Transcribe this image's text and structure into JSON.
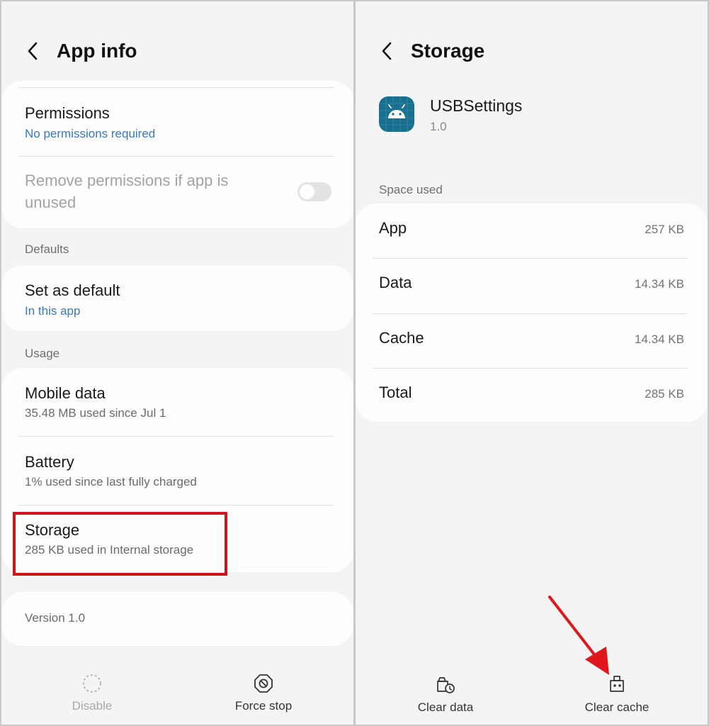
{
  "app_info": {
    "title": "App info",
    "permissions": {
      "title": "Permissions",
      "subtitle": "No permissions required"
    },
    "remove_permissions": {
      "label": "Remove permissions if app is unused",
      "enabled": false
    },
    "sections": {
      "defaults": "Defaults",
      "usage": "Usage"
    },
    "set_as_default": {
      "title": "Set as default",
      "subtitle": "In this app"
    },
    "mobile_data": {
      "title": "Mobile data",
      "subtitle": "35.48 MB used since Jul 1"
    },
    "battery": {
      "title": "Battery",
      "subtitle": "1% used since last fully charged"
    },
    "storage": {
      "title": "Storage",
      "subtitle": "285 KB used in Internal storage"
    },
    "version": "Version 1.0",
    "bottom": {
      "disable": "Disable",
      "force_stop": "Force stop"
    }
  },
  "storage": {
    "title": "Storage",
    "app_name": "USBSettings",
    "app_version": "1.0",
    "space_used_label": "Space used",
    "rows": [
      {
        "label": "App",
        "value": "257 KB"
      },
      {
        "label": "Data",
        "value": "14.34 KB"
      },
      {
        "label": "Cache",
        "value": "14.34 KB"
      },
      {
        "label": "Total",
        "value": "285 KB"
      }
    ],
    "bottom": {
      "clear_data": "Clear data",
      "clear_cache": "Clear cache"
    }
  },
  "colors": {
    "highlight": "#d0131c",
    "link_blue": "#3a78b8",
    "icon_bg": "#1a6f8f",
    "arrow": "#e0161d"
  },
  "icons": [
    "back-arrow-icon",
    "android-icon",
    "disable-icon",
    "force-stop-icon",
    "clear-data-icon",
    "clear-cache-icon"
  ]
}
